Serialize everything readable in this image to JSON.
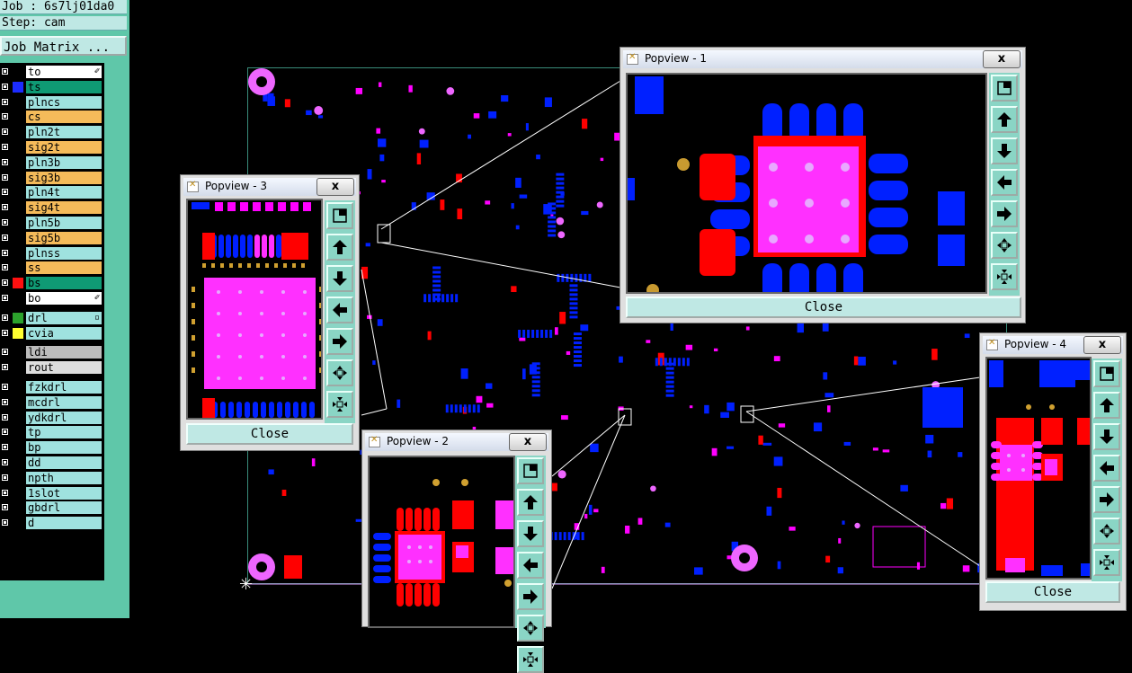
{
  "info": {
    "job": "Job : 6s7lj01da0",
    "step": "Step: cam"
  },
  "job_matrix_label": "Job Matrix ...",
  "layers": [
    {
      "name": "to",
      "bg": "#ffffff",
      "swatch": "#000000",
      "mark": "✐"
    },
    {
      "name": "ts",
      "bg": "#0f9a74",
      "swatch": "#1c2cff",
      "mark": ""
    },
    {
      "name": "plncs",
      "bg": "#9fe2df",
      "swatch": "",
      "mark": ""
    },
    {
      "name": "cs",
      "bg": "#f5bb5a",
      "swatch": "",
      "mark": ""
    },
    {
      "name": "pln2t",
      "bg": "#9fe2df",
      "swatch": "",
      "mark": ""
    },
    {
      "name": "sig2t",
      "bg": "#f5bb5a",
      "swatch": "",
      "mark": ""
    },
    {
      "name": "pln3b",
      "bg": "#9fe2df",
      "swatch": "",
      "mark": ""
    },
    {
      "name": "sig3b",
      "bg": "#f5bb5a",
      "swatch": "",
      "mark": ""
    },
    {
      "name": "pln4t",
      "bg": "#9fe2df",
      "swatch": "",
      "mark": ""
    },
    {
      "name": "sig4t",
      "bg": "#f5bb5a",
      "swatch": "",
      "mark": ""
    },
    {
      "name": "pln5b",
      "bg": "#9fe2df",
      "swatch": "",
      "mark": ""
    },
    {
      "name": "sig5b",
      "bg": "#f5bb5a",
      "swatch": "",
      "mark": ""
    },
    {
      "name": "plnss",
      "bg": "#9fe2df",
      "swatch": "",
      "mark": ""
    },
    {
      "name": "ss",
      "bg": "#f5bb5a",
      "swatch": "",
      "mark": ""
    },
    {
      "name": "bs",
      "bg": "#0f9a74",
      "swatch": "#ff1010",
      "mark": ""
    },
    {
      "name": "bo",
      "bg": "#ffffff",
      "swatch": "",
      "mark": "✐"
    },
    {
      "name": "drl",
      "bg": "#9fe2df",
      "swatch": "#2ca22c",
      "mark": "▫"
    },
    {
      "name": "cvia",
      "bg": "#9fe2df",
      "swatch": "#ffff30",
      "mark": ""
    },
    {
      "name": "ldi",
      "bg": "#bcbcbc",
      "swatch": "",
      "mark": ""
    },
    {
      "name": "rout",
      "bg": "#dddddd",
      "swatch": "",
      "mark": ""
    },
    {
      "name": "fzkdrl",
      "bg": "#9fe2df",
      "swatch": "",
      "mark": ""
    },
    {
      "name": "mcdrl",
      "bg": "#9fe2df",
      "swatch": "",
      "mark": ""
    },
    {
      "name": "ydkdrl",
      "bg": "#9fe2df",
      "swatch": "",
      "mark": ""
    },
    {
      "name": "tp",
      "bg": "#9fe2df",
      "swatch": "",
      "mark": ""
    },
    {
      "name": "bp",
      "bg": "#9fe2df",
      "swatch": "",
      "mark": ""
    },
    {
      "name": "dd",
      "bg": "#9fe2df",
      "swatch": "",
      "mark": ""
    },
    {
      "name": "npth",
      "bg": "#9fe2df",
      "swatch": "",
      "mark": ""
    },
    {
      "name": "1slot",
      "bg": "#9fe2df",
      "swatch": "",
      "mark": ""
    },
    {
      "name": "gbdrl",
      "bg": "#9fe2df",
      "swatch": "",
      "mark": ""
    },
    {
      "name": "d",
      "bg": "#9fe2df",
      "swatch": "",
      "mark": ""
    }
  ],
  "popviews": [
    {
      "id": "pv1",
      "title": "Popview - 1",
      "close_label": "Close",
      "x_label": "x"
    },
    {
      "id": "pv2",
      "title": "Popview - 2",
      "close_label": "Close",
      "x_label": "x"
    },
    {
      "id": "pv3",
      "title": "Popview - 3",
      "close_label": "Close",
      "x_label": "x"
    },
    {
      "id": "pv4",
      "title": "Popview - 4",
      "close_label": "Close",
      "x_label": "x"
    }
  ],
  "tool_icons": [
    "zoom-fit-icon",
    "pan-up-icon",
    "pan-down-icon",
    "pan-left-icon",
    "pan-right-icon",
    "zoom-in-icon",
    "zoom-out-icon"
  ],
  "colors": {
    "copper_top": "#ff00ff",
    "copper_bottom": "#0020ff",
    "pad_red": "#ff0000",
    "panel": "#5fc7a9",
    "button": "#bfe8e4"
  }
}
